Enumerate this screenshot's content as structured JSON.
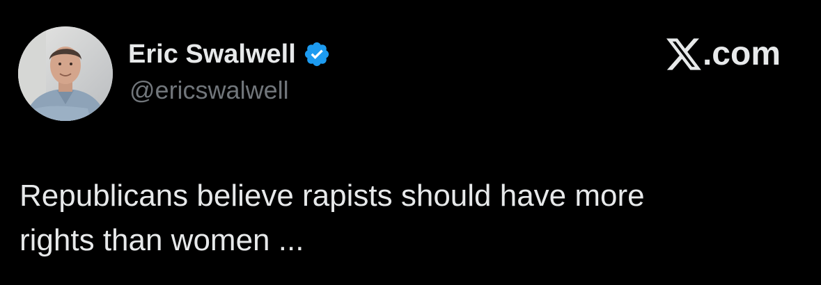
{
  "author": {
    "display_name": "Eric Swalwell",
    "handle": "@ericswalwell",
    "verified": true,
    "verified_icon": "verified-badge-icon",
    "avatar_icon": "profile-photo"
  },
  "brand": {
    "logo_icon": "x-logo-icon",
    "suffix": ".com"
  },
  "tweet": {
    "lines": [
      "Republicans believe rapists should have more",
      "rights than women ..."
    ]
  },
  "colors": {
    "background": "#000000",
    "text_primary": "#e7e9ea",
    "text_secondary": "#71767b",
    "verified_blue": "#1d9bf0"
  }
}
